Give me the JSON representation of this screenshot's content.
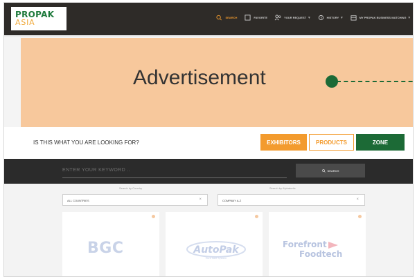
{
  "header": {
    "logo": {
      "line1": "PROPAK",
      "line2": "ASIA"
    },
    "nav": [
      {
        "label": "SEARCH",
        "icon": "search-icon"
      },
      {
        "label": "FAVORITE",
        "icon": "bookmark-icon"
      },
      {
        "label": "YOUR REQUEST",
        "icon": "users-icon"
      },
      {
        "label": "HISTORY",
        "icon": "history-icon"
      },
      {
        "label": "MY PROPAK BUSINESS MATCHING",
        "icon": "building-icon"
      }
    ]
  },
  "ad": {
    "label": "Advertisement"
  },
  "question": {
    "text": "IS THIS WHAT YOU ARE LOOKING FOR?",
    "buttons": [
      "EXHIBITORS",
      "PRODUCTS",
      "ZONE"
    ]
  },
  "search": {
    "placeholder": "ENTER YOUR KEYWORD ..",
    "button": "SEARCH"
  },
  "filters": {
    "country_label": "Search by Country",
    "country_value": "ALL COUNTRIES",
    "alpha_label": "Search by Alphabetic",
    "alpha_value": "COMPANY A-Z"
  },
  "cards": [
    {
      "name": "BGC"
    },
    {
      "name": "AutoPak",
      "tagline": "Pack Sale System"
    },
    {
      "name_line1": "Forefront",
      "name_line2": "Foodtech"
    }
  ],
  "colors": {
    "brand_green": "#1c6a36",
    "brand_orange": "#f39b2e",
    "header_bg": "#2e2b28",
    "ad_bg": "#f7c89c"
  }
}
